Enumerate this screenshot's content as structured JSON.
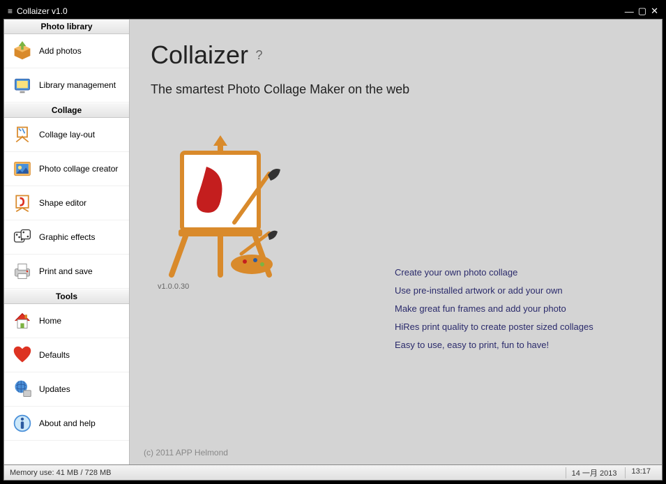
{
  "titlebar": {
    "title": "Collaizer v1.0"
  },
  "sidebar": {
    "sections": [
      {
        "header": "Photo library",
        "items": [
          {
            "label": "Add photos",
            "icon": "box-icon"
          },
          {
            "label": "Library management",
            "icon": "folder-screen-icon"
          }
        ]
      },
      {
        "header": "Collage",
        "items": [
          {
            "label": "Collage lay-out",
            "icon": "easel-icon"
          },
          {
            "label": "Photo collage creator",
            "icon": "photo-icon"
          },
          {
            "label": "Shape editor",
            "icon": "shape-icon"
          },
          {
            "label": "Graphic effects",
            "icon": "dice-icon"
          },
          {
            "label": "Print and save",
            "icon": "printer-icon"
          }
        ]
      },
      {
        "header": "Tools",
        "items": [
          {
            "label": "Home",
            "icon": "home-icon"
          },
          {
            "label": "Defaults",
            "icon": "heart-icon"
          },
          {
            "label": "Updates",
            "icon": "globe-icon"
          },
          {
            "label": "About and help",
            "icon": "info-icon"
          }
        ]
      }
    ]
  },
  "main": {
    "title": "Collaizer",
    "help": "?",
    "tagline": "The smartest Photo Collage Maker on the web",
    "version": "v1.0.0.30",
    "features": [
      "Create your own photo collage",
      "Use pre-installed artwork or add your own",
      "Make great fun frames and add your photo",
      "HiRes print quality to create poster sized collages",
      "Easy to use, easy to print, fun to have!"
    ],
    "copyright": "(c) 2011 APP Helmond"
  },
  "statusbar": {
    "memory": "Memory use: 41 MB / 728 MB",
    "date": "14 一月 2013",
    "time": "13:17"
  }
}
